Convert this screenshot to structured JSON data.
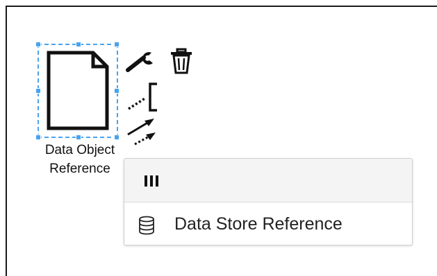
{
  "diagram": {
    "selected_element": {
      "label_line1": "Data Object",
      "label_line2": "Reference"
    }
  },
  "context_pad": {
    "icons": [
      "wrench-icon",
      "trash-icon",
      "text-annotation-icon",
      "connect-arrow-icon"
    ]
  },
  "replace_menu": {
    "header_icon": "grip-bars-icon",
    "items": [
      {
        "icon": "database-icon",
        "label": "Data Store Reference"
      }
    ]
  },
  "colors": {
    "selection": "#4aa3f0",
    "stroke": "#1a1a1a",
    "menu_header": "#f4f4f4"
  }
}
